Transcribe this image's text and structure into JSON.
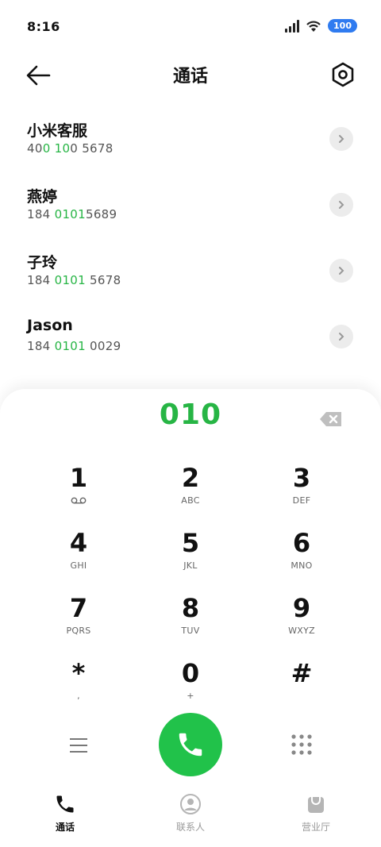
{
  "status": {
    "time": "8:16",
    "battery": "100"
  },
  "header": {
    "title": "通话"
  },
  "contacts": [
    {
      "name": "小米客服",
      "number_pre": "40",
      "number_hl": "0 10",
      "number_post": "0 5678"
    },
    {
      "name": "燕婷",
      "number_pre": "184 ",
      "number_hl": "0101",
      "number_post": "5689"
    },
    {
      "name": "子玲",
      "number_pre": "184 ",
      "number_hl": "0101",
      "number_post": " 5678"
    },
    {
      "name": "Jason",
      "number_pre": "184 ",
      "number_hl": "0101",
      "number_post": " 0029"
    }
  ],
  "dialer": {
    "input": "010",
    "keys": [
      {
        "digit": "1",
        "letters": "voicemail"
      },
      {
        "digit": "2",
        "letters": "ABC"
      },
      {
        "digit": "3",
        "letters": "DEF"
      },
      {
        "digit": "4",
        "letters": "GHI"
      },
      {
        "digit": "5",
        "letters": "JKL"
      },
      {
        "digit": "6",
        "letters": "MNO"
      },
      {
        "digit": "7",
        "letters": "PQRS"
      },
      {
        "digit": "8",
        "letters": "TUV"
      },
      {
        "digit": "9",
        "letters": "WXYZ"
      },
      {
        "digit": "*",
        "letters": ","
      },
      {
        "digit": "0",
        "letters": "+"
      },
      {
        "digit": "#",
        "letters": ""
      }
    ]
  },
  "nav": {
    "tabs": [
      {
        "label": "通话",
        "icon": "phone-icon",
        "active": true
      },
      {
        "label": "联系人",
        "icon": "person-icon",
        "active": false
      },
      {
        "label": "营业厅",
        "icon": "store-icon",
        "active": false
      }
    ]
  },
  "colors": {
    "accent": "#27b545",
    "call": "#21c24a",
    "battery": "#2f7bf0"
  }
}
